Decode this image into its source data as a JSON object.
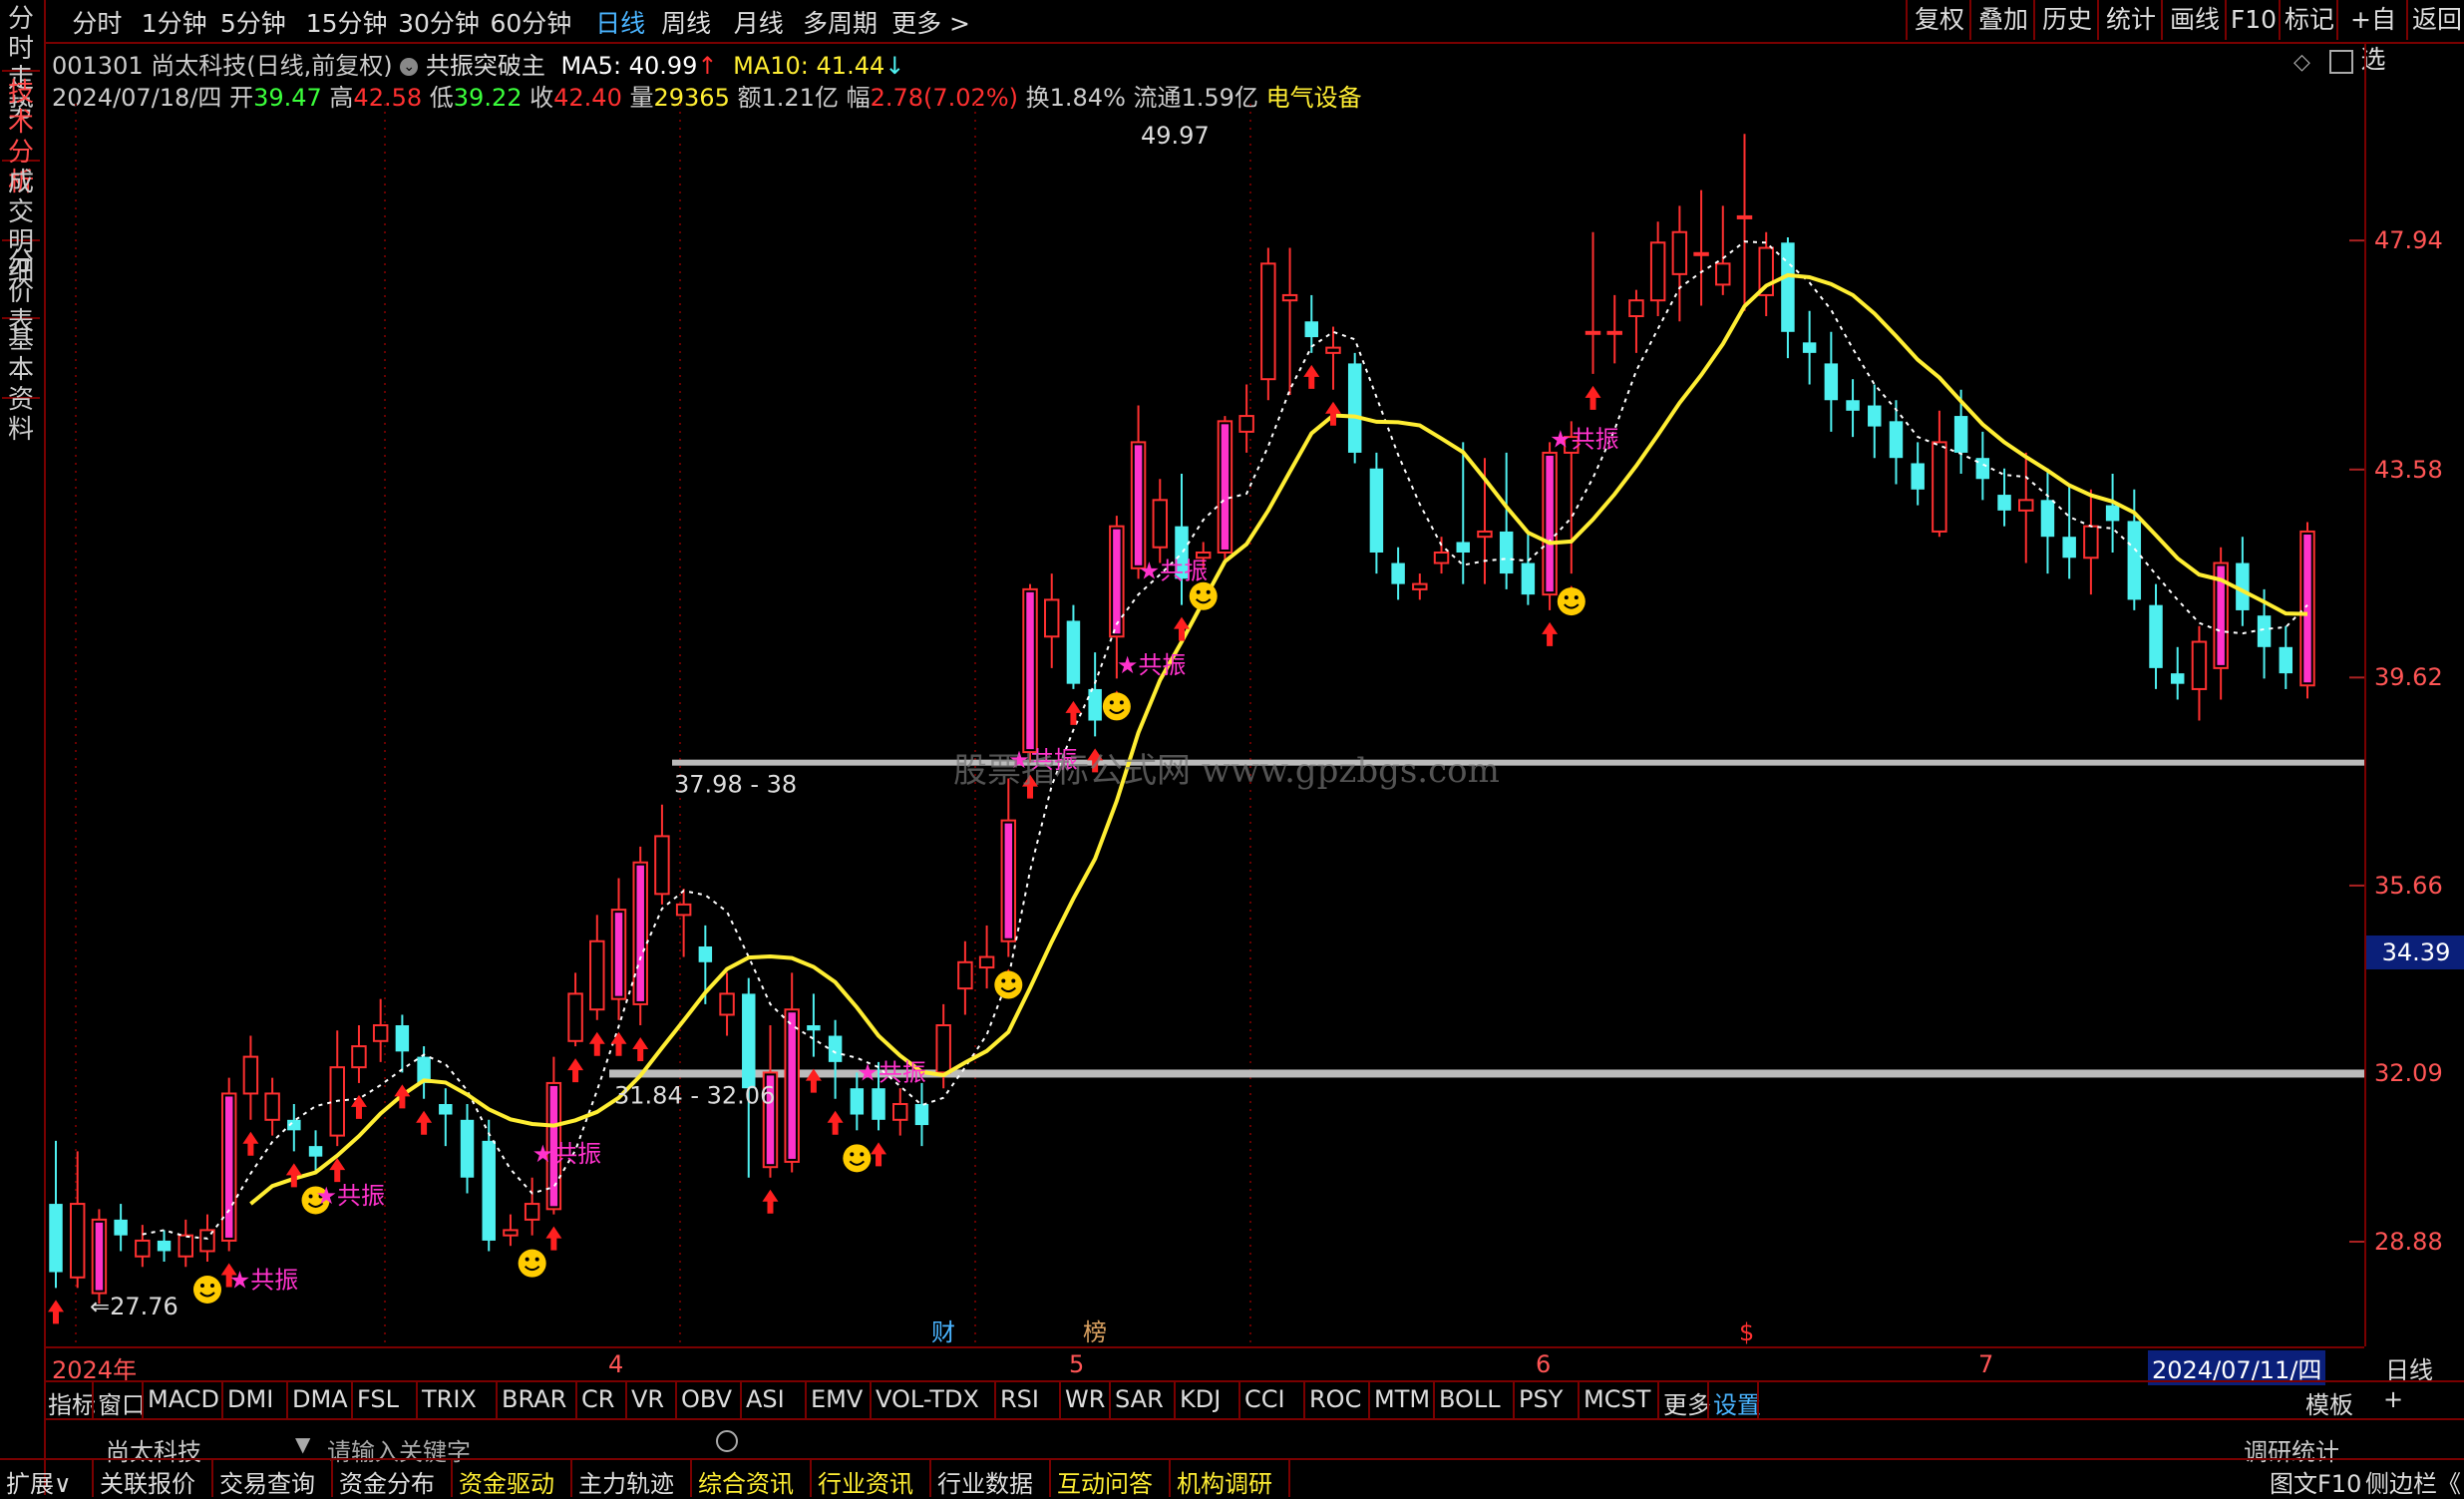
{
  "top_menu": [
    "分时",
    "1分钟",
    "5分钟",
    "15分钟",
    "30分钟",
    "60分钟",
    "日线",
    "周线",
    "月线",
    "多周期",
    "更多 >"
  ],
  "top_menu_active": "日线",
  "right_buttons": [
    "复权",
    "叠加",
    "历史",
    "统计",
    "画线",
    "F10",
    "标记",
    "+自选",
    "返回"
  ],
  "left_tabs": [
    "分时走势",
    "技术分析",
    "成交明细",
    "分价表",
    "基本资料"
  ],
  "left_tab_active": "技术分析",
  "info_line1": {
    "code": "001301",
    "name": "尚太科技",
    "mode": "(日线,前复权)",
    "indicator": "共振突破主",
    "ma5_label": "MA5:",
    "ma5_value": "40.99",
    "ma10_label": "MA10:",
    "ma10_value": "41.44"
  },
  "info_line2": {
    "date": "2024/07/18/四",
    "open_label": "开",
    "open": "39.47",
    "high_label": "高",
    "high": "42.58",
    "low_label": "低",
    "low": "39.22",
    "close_label": "收",
    "close": "42.40",
    "vol_label": "量",
    "vol": "29365",
    "amt_label": "额",
    "amt": "1.21亿",
    "chg_label": "幅",
    "chg": "2.78(7.02%)",
    "turn_label": "换",
    "turn": "1.84%",
    "float_label": "流通",
    "float": "1.59亿",
    "sector": "电气设备"
  },
  "price_labels": [
    "47.94",
    "43.58",
    "39.62",
    "35.66",
    "32.09",
    "28.88"
  ],
  "current_price": "34.39",
  "date_labels": [
    "2024年",
    "4",
    "5",
    "6",
    "7"
  ],
  "date_cursor": "2024/07/11/四",
  "date_period": "日线",
  "markers": [
    "财",
    "榜",
    "$"
  ],
  "annotations": {
    "high": "49.97",
    "low": "27.76",
    "zone1": "37.98 - 38",
    "zone2": "31.84 - 32.06",
    "signal": "共振",
    "watermark": "股票指标公式网 www.gpzbgs.com"
  },
  "indicator_tabs": [
    "指标",
    "窗口",
    "MACD",
    "DMI",
    "DMA",
    "FSL",
    "TRIX",
    "BRAR",
    "CR",
    "VR",
    "OBV",
    "ASI",
    "EMV",
    "VOL-TDX",
    "RSI",
    "WR",
    "SAR",
    "KDJ",
    "CCI",
    "ROC",
    "MTM",
    "BOLL",
    "PSY",
    "MCST",
    "更多",
    "设置"
  ],
  "indicator_right": [
    "模板",
    "+"
  ],
  "hidden_row": {
    "name": "尚太科技",
    "search_placeholder": "请输入关键字",
    "right": "调研统计"
  },
  "bottom_tabs": [
    "扩展∨",
    "关联报价",
    "交易查询",
    "资金分布",
    "资金驱动",
    "主力轨迹",
    "综合资讯",
    "行业资讯",
    "行业数据",
    "互动问答",
    "机构调研"
  ],
  "bottom_right": [
    "图文F10",
    "侧边栏《"
  ],
  "colors": {
    "up": "#ff3030",
    "down": "#4ff0f0",
    "ma": "#ffee33",
    "magenta": "#ff33cc",
    "frame": "#7a0000"
  },
  "chart_data": {
    "type": "candlestick",
    "ylim": [
      27.0,
      51.0
    ],
    "candles": [
      [
        29.6,
        28.3,
        30.8,
        28.0
      ],
      [
        28.2,
        29.6,
        30.6,
        28.0
      ],
      [
        27.9,
        29.3,
        29.5,
        27.7
      ],
      [
        29.3,
        29.0,
        29.6,
        28.7
      ],
      [
        28.6,
        28.9,
        29.2,
        28.4
      ],
      [
        28.9,
        28.7,
        29.1,
        28.5
      ],
      [
        28.6,
        29.0,
        29.3,
        28.4
      ],
      [
        28.7,
        29.1,
        29.4,
        28.5
      ],
      [
        28.9,
        31.7,
        32.0,
        28.7
      ],
      [
        31.7,
        32.4,
        32.8,
        31.2
      ],
      [
        31.2,
        31.7,
        32.0,
        30.9
      ],
      [
        31.2,
        31.0,
        31.5,
        30.6
      ],
      [
        30.7,
        30.5,
        31.0,
        30.2
      ],
      [
        30.9,
        32.2,
        32.9,
        30.7
      ],
      [
        32.2,
        32.6,
        33.0,
        31.9
      ],
      [
        32.7,
        33.0,
        33.5,
        32.3
      ],
      [
        33.0,
        32.5,
        33.2,
        32.1
      ],
      [
        32.4,
        31.9,
        32.6,
        31.6
      ],
      [
        31.5,
        31.3,
        31.8,
        30.7
      ],
      [
        31.2,
        30.1,
        31.5,
        29.8
      ],
      [
        30.8,
        28.9,
        31.2,
        28.7
      ],
      [
        29.0,
        29.1,
        29.4,
        28.8
      ],
      [
        29.3,
        29.6,
        30.1,
        29.0
      ],
      [
        29.5,
        31.9,
        32.4,
        29.4
      ],
      [
        32.7,
        33.6,
        34.0,
        32.6
      ],
      [
        33.3,
        34.6,
        35.1,
        33.1
      ],
      [
        33.5,
        35.2,
        35.8,
        33.1
      ],
      [
        33.4,
        36.1,
        36.4,
        33.0
      ],
      [
        35.5,
        36.6,
        37.2,
        35.3
      ],
      [
        35.1,
        35.3,
        35.6,
        34.3
      ],
      [
        34.5,
        34.2,
        34.9,
        33.4
      ],
      [
        33.2,
        33.6,
        34.0,
        32.8
      ],
      [
        33.6,
        31.8,
        33.9,
        30.1
      ],
      [
        30.3,
        32.1,
        33.0,
        30.1
      ],
      [
        30.4,
        33.3,
        34.0,
        30.2
      ],
      [
        33.0,
        32.9,
        33.6,
        32.4
      ],
      [
        32.8,
        32.3,
        33.1,
        31.6
      ],
      [
        31.8,
        31.3,
        32.1,
        31.0
      ],
      [
        31.8,
        31.2,
        32.3,
        31.0
      ],
      [
        31.2,
        31.5,
        31.8,
        30.9
      ],
      [
        31.5,
        31.1,
        31.9,
        30.7
      ],
      [
        32.1,
        33.0,
        33.4,
        31.8
      ],
      [
        33.7,
        34.2,
        34.6,
        33.2
      ],
      [
        34.1,
        34.3,
        34.9,
        33.7
      ],
      [
        34.6,
        36.9,
        37.7,
        34.3
      ],
      [
        38.2,
        41.3,
        41.4,
        38.0
      ],
      [
        40.4,
        41.1,
        41.6,
        39.8
      ],
      [
        40.7,
        39.5,
        41.0,
        39.4
      ],
      [
        39.4,
        38.8,
        40.1,
        38.5
      ],
      [
        40.4,
        42.5,
        42.7,
        39.6
      ],
      [
        41.7,
        44.1,
        44.8,
        41.5
      ],
      [
        42.1,
        43.0,
        43.4,
        41.8
      ],
      [
        42.5,
        41.5,
        43.5,
        41.0
      ],
      [
        41.9,
        42.0,
        42.2,
        41.7
      ],
      [
        42.0,
        44.5,
        44.6,
        41.8
      ],
      [
        44.3,
        44.6,
        45.2,
        43.9
      ],
      [
        45.3,
        47.5,
        47.8,
        44.9
      ],
      [
        46.8,
        46.9,
        47.8,
        45.0
      ],
      [
        46.4,
        46.1,
        46.9,
        45.8
      ],
      [
        45.8,
        45.9,
        46.3,
        45.1
      ],
      [
        45.6,
        43.9,
        45.8,
        43.7
      ],
      [
        43.6,
        42.0,
        43.9,
        41.6
      ],
      [
        41.8,
        41.4,
        42.1,
        41.1
      ],
      [
        41.3,
        41.4,
        41.6,
        41.1
      ],
      [
        41.8,
        42.0,
        42.3,
        41.6
      ],
      [
        42.2,
        42.0,
        44.1,
        41.4
      ],
      [
        42.3,
        42.4,
        43.8,
        41.4
      ],
      [
        42.4,
        41.6,
        43.9,
        41.3
      ],
      [
        41.8,
        41.2,
        42.4,
        41.0
      ],
      [
        41.2,
        43.9,
        44.1,
        40.9
      ],
      [
        43.9,
        44.2,
        44.5,
        41.6
      ],
      [
        46.2,
        46.2,
        48.1,
        45.4
      ],
      [
        46.2,
        46.2,
        46.9,
        45.6
      ],
      [
        46.5,
        46.8,
        47.0,
        45.8
      ],
      [
        46.8,
        47.9,
        48.3,
        46.5
      ],
      [
        47.3,
        48.1,
        48.6,
        46.4
      ],
      [
        47.7,
        47.7,
        48.9,
        46.7
      ],
      [
        47.1,
        47.5,
        48.6,
        46.9
      ],
      [
        48.4,
        48.4,
        49.97,
        46.6
      ],
      [
        46.9,
        47.8,
        48.1,
        46.5
      ],
      [
        47.9,
        46.2,
        48.0,
        45.7
      ],
      [
        46.0,
        45.8,
        46.6,
        45.2
      ],
      [
        45.6,
        44.9,
        46.2,
        44.3
      ],
      [
        44.9,
        44.7,
        45.3,
        44.2
      ],
      [
        44.8,
        44.4,
        45.2,
        43.8
      ],
      [
        44.5,
        43.8,
        44.9,
        43.3
      ],
      [
        43.7,
        43.2,
        44.1,
        42.9
      ],
      [
        42.4,
        44.1,
        44.7,
        42.3
      ],
      [
        44.6,
        43.9,
        45.1,
        43.5
      ],
      [
        43.8,
        43.4,
        44.3,
        43.0
      ],
      [
        43.1,
        42.8,
        43.6,
        42.5
      ],
      [
        42.8,
        43.0,
        43.9,
        41.8
      ],
      [
        43.0,
        42.3,
        43.6,
        41.6
      ],
      [
        42.3,
        41.9,
        43.3,
        41.5
      ],
      [
        41.9,
        42.5,
        43.2,
        41.2
      ],
      [
        42.9,
        42.6,
        43.5,
        42.0
      ],
      [
        42.6,
        41.1,
        43.2,
        40.9
      ],
      [
        41.0,
        39.8,
        41.4,
        39.4
      ],
      [
        39.7,
        39.5,
        40.2,
        39.2
      ],
      [
        39.4,
        40.3,
        40.6,
        38.8
      ],
      [
        39.8,
        41.8,
        42.1,
        39.2
      ],
      [
        41.8,
        40.9,
        42.3,
        40.6
      ],
      [
        40.8,
        40.2,
        41.3,
        39.6
      ],
      [
        40.2,
        39.7,
        40.6,
        39.4
      ],
      [
        39.47,
        42.4,
        42.58,
        39.22
      ]
    ]
  }
}
